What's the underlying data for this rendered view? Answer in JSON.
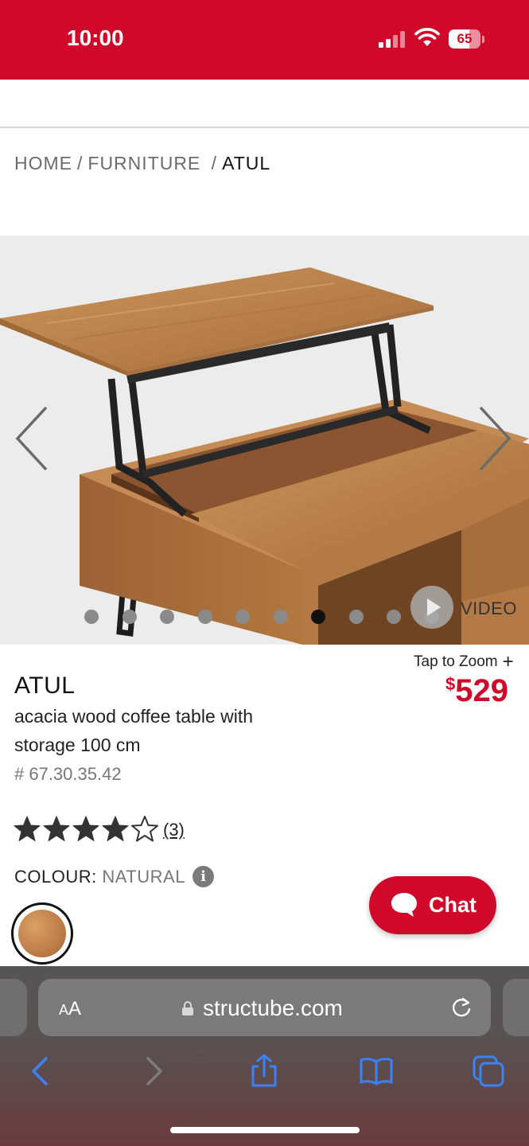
{
  "status_bar": {
    "time": "10:00",
    "battery": "65",
    "battery_level": 0.65
  },
  "breadcrumb": {
    "home": "HOME",
    "sep1": "/",
    "furniture": "FURNITURE",
    "sep2": "/",
    "current": "ATUL"
  },
  "gallery": {
    "slide_count": 10,
    "active_slide": 7,
    "video_label": "VIDEO"
  },
  "product": {
    "zoom_label": "Tap to Zoom",
    "zoom_plus": "+",
    "name": "ATUL",
    "description": "acacia wood coffee table with storage 100 cm",
    "sku": "# 67.30.35.42",
    "price_currency": "$",
    "price_amount": "529",
    "rating": 4,
    "rating_max": 5,
    "review_count": "(3)",
    "colour_label": "COLOUR:",
    "colour_value": "NATURAL",
    "info_glyph": "i"
  },
  "chat": {
    "label": "Chat"
  },
  "browser": {
    "aa_small": "A",
    "aa_big": "A",
    "url": "structube.com"
  },
  "colors": {
    "brand_red": "#d0092a",
    "ios_blue": "#3b82f6"
  },
  "icons": [
    "signal-icon",
    "wifi-icon",
    "battery-icon",
    "chevron-left-icon",
    "chevron-right-icon",
    "play-icon",
    "star-icon",
    "info-icon",
    "chat-bubble-icon",
    "lock-icon",
    "reload-icon",
    "back-icon",
    "forward-icon",
    "share-icon",
    "bookmarks-icon",
    "tabs-icon"
  ]
}
